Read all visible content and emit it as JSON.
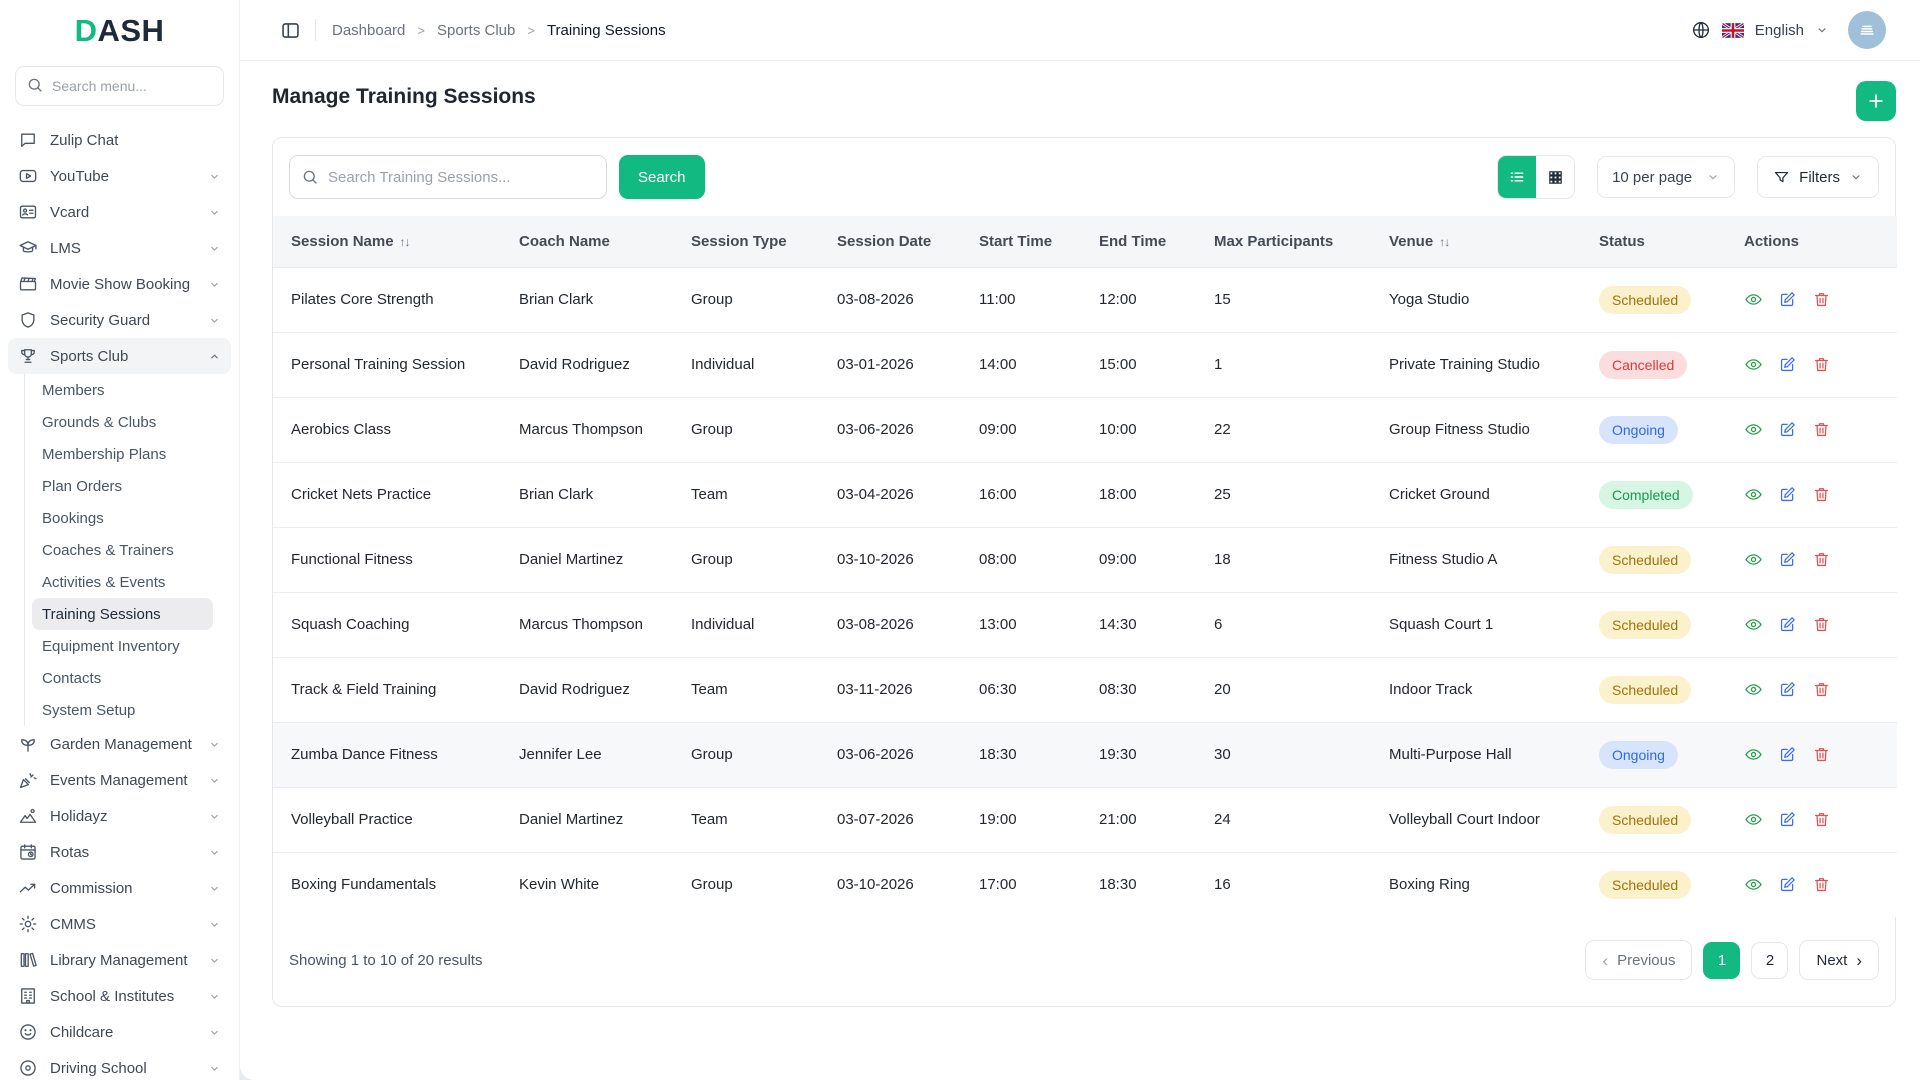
{
  "app": {
    "logo_accent": "D",
    "logo_rest": "ASH",
    "accent_color": "#12b981"
  },
  "sidebar": {
    "search_placeholder": "Search menu...",
    "items": [
      {
        "label": "Zulip Chat",
        "icon": "chat-icon",
        "chevron": false
      },
      {
        "label": "YouTube",
        "icon": "youtube-icon",
        "chevron": true
      },
      {
        "label": "Vcard",
        "icon": "idcard-icon",
        "chevron": true
      },
      {
        "label": "LMS",
        "icon": "graduation-icon",
        "chevron": true
      },
      {
        "label": "Movie Show Booking",
        "icon": "clapperboard-icon",
        "chevron": true
      },
      {
        "label": "Security Guard",
        "icon": "shield-icon",
        "chevron": true
      },
      {
        "label": "Sports Club",
        "icon": "trophy-icon",
        "chevron": true,
        "expanded": true,
        "active": true,
        "children": [
          "Members",
          "Grounds & Clubs",
          "Membership Plans",
          "Plan Orders",
          "Bookings",
          "Coaches & Trainers",
          "Activities & Events",
          "Training Sessions",
          "Equipment Inventory",
          "Contacts",
          "System Setup"
        ],
        "active_child": "Training Sessions"
      },
      {
        "label": "Garden Management",
        "icon": "sprout-icon",
        "chevron": true
      },
      {
        "label": "Events Management",
        "icon": "party-icon",
        "chevron": true
      },
      {
        "label": "Holidayz",
        "icon": "mountain-icon",
        "chevron": true
      },
      {
        "label": "Rotas",
        "icon": "calendar-clock-icon",
        "chevron": true
      },
      {
        "label": "Commission",
        "icon": "trend-icon",
        "chevron": true
      },
      {
        "label": "CMMS",
        "icon": "gear-icon",
        "chevron": true
      },
      {
        "label": "Library Management",
        "icon": "library-icon",
        "chevron": true
      },
      {
        "label": "School & Institutes",
        "icon": "building-icon",
        "chevron": true
      },
      {
        "label": "Childcare",
        "icon": "smiley-icon",
        "chevron": true
      },
      {
        "label": "Driving School",
        "icon": "target-icon",
        "chevron": true
      }
    ]
  },
  "topbar": {
    "breadcrumb": [
      "Dashboard",
      "Sports Club",
      "Training Sessions"
    ],
    "language": "English"
  },
  "page": {
    "title": "Manage Training Sessions"
  },
  "toolbar": {
    "search_placeholder": "Search Training Sessions...",
    "search_label": "Search",
    "per_page": "10 per page",
    "filters_label": "Filters"
  },
  "table": {
    "columns": [
      {
        "label": "Session Name",
        "sortable": true
      },
      {
        "label": "Coach Name",
        "sortable": false
      },
      {
        "label": "Session Type",
        "sortable": false
      },
      {
        "label": "Session Date",
        "sortable": false
      },
      {
        "label": "Start Time",
        "sortable": false
      },
      {
        "label": "End Time",
        "sortable": false
      },
      {
        "label": "Max Participants",
        "sortable": false
      },
      {
        "label": "Venue",
        "sortable": true
      },
      {
        "label": "Status",
        "sortable": false
      },
      {
        "label": "Actions",
        "sortable": false
      }
    ],
    "rows": [
      {
        "session": "Pilates Core Strength",
        "coach": "Brian Clark",
        "type": "Group",
        "date": "03-08-2026",
        "start": "11:00",
        "end": "12:00",
        "max": "15",
        "venue": "Yoga Studio",
        "status": "Scheduled",
        "shaded": false
      },
      {
        "session": "Personal Training Session",
        "coach": "David Rodriguez",
        "type": "Individual",
        "date": "03-01-2026",
        "start": "14:00",
        "end": "15:00",
        "max": "1",
        "venue": "Private Training Studio",
        "status": "Cancelled",
        "shaded": false
      },
      {
        "session": "Aerobics Class",
        "coach": "Marcus Thompson",
        "type": "Group",
        "date": "03-06-2026",
        "start": "09:00",
        "end": "10:00",
        "max": "22",
        "venue": "Group Fitness Studio",
        "status": "Ongoing",
        "shaded": false
      },
      {
        "session": "Cricket Nets Practice",
        "coach": "Brian Clark",
        "type": "Team",
        "date": "03-04-2026",
        "start": "16:00",
        "end": "18:00",
        "max": "25",
        "venue": "Cricket Ground",
        "status": "Completed",
        "shaded": false
      },
      {
        "session": "Functional Fitness",
        "coach": "Daniel Martinez",
        "type": "Group",
        "date": "03-10-2026",
        "start": "08:00",
        "end": "09:00",
        "max": "18",
        "venue": "Fitness Studio A",
        "status": "Scheduled",
        "shaded": false
      },
      {
        "session": "Squash Coaching",
        "coach": "Marcus Thompson",
        "type": "Individual",
        "date": "03-08-2026",
        "start": "13:00",
        "end": "14:30",
        "max": "6",
        "venue": "Squash Court 1",
        "status": "Scheduled",
        "shaded": false
      },
      {
        "session": "Track & Field Training",
        "coach": "David Rodriguez",
        "type": "Team",
        "date": "03-11-2026",
        "start": "06:30",
        "end": "08:30",
        "max": "20",
        "venue": "Indoor Track",
        "status": "Scheduled",
        "shaded": false
      },
      {
        "session": "Zumba Dance Fitness",
        "coach": "Jennifer Lee",
        "type": "Group",
        "date": "03-06-2026",
        "start": "18:30",
        "end": "19:30",
        "max": "30",
        "venue": "Multi-Purpose Hall",
        "status": "Ongoing",
        "shaded": true
      },
      {
        "session": "Volleyball Practice",
        "coach": "Daniel Martinez",
        "type": "Team",
        "date": "03-07-2026",
        "start": "19:00",
        "end": "21:00",
        "max": "24",
        "venue": "Volleyball Court Indoor",
        "status": "Scheduled",
        "shaded": false
      },
      {
        "session": "Boxing Fundamentals",
        "coach": "Kevin White",
        "type": "Group",
        "date": "03-10-2026",
        "start": "17:00",
        "end": "18:30",
        "max": "16",
        "venue": "Boxing Ring",
        "status": "Scheduled",
        "shaded": false
      }
    ]
  },
  "status_colors": {
    "Scheduled": {
      "bg": "#fcf1cd",
      "fg": "#a17207"
    },
    "Cancelled": {
      "bg": "#fbdddd",
      "fg": "#d63c3c"
    },
    "Ongoing": {
      "bg": "#d8e4fb",
      "fg": "#2f6bdf"
    },
    "Completed": {
      "bg": "#d6f5e2",
      "fg": "#189b4e"
    }
  },
  "footer": {
    "summary": "Showing 1 to 10 of 20 results",
    "previous_label": "Previous",
    "pages": [
      "1",
      "2"
    ],
    "active_page": "1",
    "next_label": "Next"
  }
}
